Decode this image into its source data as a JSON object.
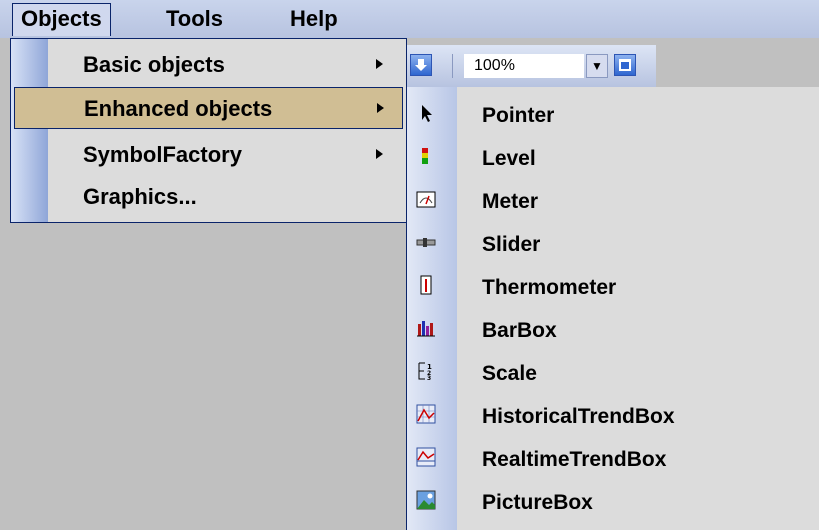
{
  "menubar": {
    "items": [
      "Objects",
      "Tools",
      "Help"
    ]
  },
  "toolbar": {
    "zoom_value": "100%"
  },
  "objects_menu": {
    "items": [
      {
        "label": "Basic objects",
        "submenu": true
      },
      {
        "label": "Enhanced objects",
        "submenu": true,
        "selected": true
      },
      {
        "label": "SymbolFactory",
        "submenu": true
      },
      {
        "label": "Graphics...",
        "submenu": false
      }
    ]
  },
  "enhanced_submenu": {
    "items": [
      {
        "label": "Pointer",
        "icon": "pointer-icon"
      },
      {
        "label": "Level",
        "icon": "level-icon"
      },
      {
        "label": "Meter",
        "icon": "meter-icon"
      },
      {
        "label": "Slider",
        "icon": "slider-icon"
      },
      {
        "label": "Thermometer",
        "icon": "thermometer-icon"
      },
      {
        "label": "BarBox",
        "icon": "barbox-icon"
      },
      {
        "label": "Scale",
        "icon": "scale-icon"
      },
      {
        "label": "HistoricalTrendBox",
        "icon": "historical-trend-icon"
      },
      {
        "label": "RealtimeTrendBox",
        "icon": "realtime-trend-icon"
      },
      {
        "label": "PictureBox",
        "icon": "picture-icon"
      }
    ]
  },
  "colors": {
    "menubar": "#b7c3e0",
    "menu_bg": "#dcdcdc",
    "selection": "#d0be94",
    "border": "#0a246a"
  }
}
